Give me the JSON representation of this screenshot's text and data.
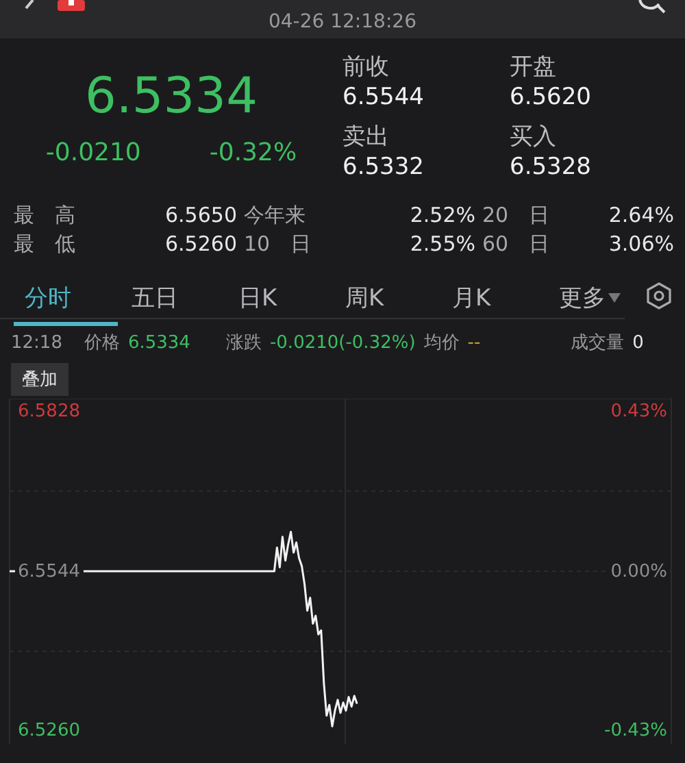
{
  "top_bar": {
    "datetime": "04-26 12:18:26"
  },
  "quote": {
    "price": "6.5334",
    "change": "-0.0210",
    "change_percent": "-0.32%"
  },
  "quote_fields": [
    {
      "label": "前收",
      "value": "6.5544"
    },
    {
      "label": "开盘",
      "value": "6.5620"
    },
    {
      "label": "卖出",
      "value": "6.5332"
    },
    {
      "label": "买入",
      "value": "6.5328"
    }
  ],
  "stats": [
    [
      {
        "label": "最　高",
        "value": "6.5650"
      },
      {
        "label": "今年来",
        "value": "2.52%"
      },
      {
        "label": "20　日",
        "value": "2.64%"
      }
    ],
    [
      {
        "label": "最　低",
        "value": "6.5260"
      },
      {
        "label": "10　日",
        "value": "2.55%"
      },
      {
        "label": "60　日",
        "value": "3.06%"
      }
    ]
  ],
  "tabs": [
    {
      "label": "分时",
      "selected": true
    },
    {
      "label": "五日",
      "selected": false
    },
    {
      "label": "日K",
      "selected": false
    },
    {
      "label": "周K",
      "selected": false
    },
    {
      "label": "月K",
      "selected": false
    },
    {
      "label": "更多",
      "selected": false,
      "dropdown": true
    }
  ],
  "info_row": {
    "time": "12:18",
    "price_label": "价格",
    "price": "6.5334",
    "change_label": "涨跌",
    "change": "-0.0210(-0.32%)",
    "avg_label": "均价",
    "avg": "--",
    "volume_label": "成交量",
    "volume": "0"
  },
  "overlay_button": "叠加",
  "chart": {
    "right_labels": [
      "0.43%",
      "0.00%",
      "-0.43%"
    ],
    "chart_data": {
      "type": "line",
      "ylim": [
        6.5238,
        6.585
      ],
      "yticks": [
        {
          "value": 6.5828,
          "label": "6.5828"
        },
        {
          "value": 6.5544,
          "label": "6.5544"
        },
        {
          "value": 6.526,
          "label": "6.5260"
        }
      ],
      "categories": [
        null,
        null,
        null,
        null,
        null,
        null,
        null,
        null,
        null,
        null,
        null,
        null,
        null,
        null,
        null,
        null,
        null,
        null,
        null,
        null,
        null,
        null,
        null,
        null,
        null,
        null,
        null,
        null,
        null,
        null,
        null,
        null,
        null,
        null,
        null,
        null,
        null,
        null,
        null,
        null,
        null,
        null,
        null,
        null,
        null,
        null,
        null,
        null,
        null,
        null,
        null,
        null,
        null,
        null,
        null,
        null,
        null,
        null,
        null,
        null,
        null,
        null,
        null,
        null,
        null,
        null,
        null,
        null,
        null,
        null,
        null,
        null,
        null,
        null,
        null,
        null,
        null,
        null,
        null,
        null,
        null,
        null,
        null,
        null,
        null,
        null,
        null,
        null,
        null,
        null,
        null,
        null,
        null,
        null,
        null,
        null,
        null,
        null,
        null,
        null,
        null,
        null,
        null,
        null,
        null,
        null,
        null,
        null,
        null,
        null,
        null,
        null,
        null,
        null,
        null,
        null,
        null,
        null,
        null,
        null,
        null,
        null,
        null,
        null,
        null,
        null,
        null,
        null,
        null,
        null,
        null,
        null,
        null,
        null,
        null,
        null,
        null,
        null,
        null,
        null,
        null,
        null,
        null,
        null,
        null,
        null,
        null,
        null,
        null,
        null,
        null,
        null,
        null,
        null,
        null,
        null,
        null,
        null,
        null,
        null,
        null,
        null,
        null,
        null,
        null,
        null,
        null,
        null,
        null,
        null,
        null,
        null,
        null,
        null,
        null,
        null,
        null,
        null,
        null,
        null,
        null,
        null,
        null,
        null,
        null,
        null,
        null,
        null,
        null,
        null,
        null,
        null,
        null,
        null,
        null,
        null,
        null,
        null,
        null,
        null,
        null,
        null,
        null,
        null,
        null,
        null,
        null,
        null,
        null,
        null,
        null,
        null,
        null,
        null,
        null,
        null,
        null,
        null,
        null,
        null,
        null,
        null,
        null,
        null,
        null,
        null,
        null,
        null,
        null,
        null,
        null,
        null,
        null,
        null,
        null,
        null,
        null,
        null,
        null,
        null,
        null
      ],
      "series": [
        {
          "color": "#f2f2f2",
          "values": [
            6.5544,
            6.5544,
            6.5544,
            6.5544,
            6.5544,
            6.5544,
            6.5544,
            6.5544,
            6.5544,
            6.5544,
            6.5544,
            6.5544,
            6.5544,
            6.5544,
            6.5544,
            6.5544,
            6.5544,
            6.5544,
            6.5544,
            6.5544,
            6.5544,
            6.5544,
            6.5544,
            6.5544,
            6.5544,
            6.5544,
            6.5544,
            6.5544,
            6.5544,
            6.5544,
            6.5544,
            6.5544,
            6.5544,
            6.5544,
            6.5544,
            6.5544,
            6.5544,
            6.5544,
            6.5544,
            6.5544,
            6.5544,
            6.5544,
            6.5544,
            6.5544,
            6.5544,
            6.5544,
            6.5544,
            6.5544,
            6.5544,
            6.5544,
            6.5544,
            6.5544,
            6.5544,
            6.5544,
            6.5544,
            6.5544,
            6.5544,
            6.5544,
            6.5544,
            6.5544,
            6.5544,
            6.5544,
            6.5544,
            6.5544,
            6.5544,
            6.5544,
            6.5544,
            6.5544,
            6.5544,
            6.5544,
            6.5544,
            6.5544,
            6.5544,
            6.5544,
            6.5544,
            6.5544,
            6.5544,
            6.5544,
            6.5544,
            6.5544,
            6.5544,
            6.5544,
            6.5544,
            6.5544,
            6.5544,
            6.5544,
            6.5544,
            6.5544,
            6.5544,
            6.5544,
            6.5544,
            6.5544,
            6.5544,
            6.5544,
            6.5544,
            6.5544,
            6.5544,
            6.5586,
            6.5551,
            6.5605,
            6.5563,
            6.5591,
            6.5614,
            6.5577,
            6.5595,
            6.5567,
            6.5553,
            6.5521,
            6.5474,
            6.5497,
            6.5451,
            6.5465,
            6.5432,
            6.5439,
            6.5346,
            6.5288,
            6.5307,
            6.5269,
            6.5297,
            6.5316,
            6.5293,
            6.5311,
            6.5297,
            6.5321,
            6.5304,
            6.5323,
            6.5309,
            null,
            null,
            null,
            null,
            null,
            null,
            null,
            null,
            null,
            null,
            null,
            null,
            null,
            null,
            null,
            null,
            null,
            null,
            null,
            null,
            null,
            null,
            null,
            null,
            null,
            null,
            null,
            null,
            null,
            null,
            null,
            null,
            null,
            null,
            null,
            null,
            null,
            null,
            null,
            null,
            null,
            null,
            null,
            null,
            null,
            null,
            null,
            null,
            null,
            null,
            null,
            null,
            null,
            null,
            null,
            null,
            null,
            null,
            null,
            null,
            null,
            null,
            null,
            null,
            null,
            null,
            null,
            null,
            null,
            null,
            null,
            null,
            null,
            null,
            null,
            null,
            null,
            null,
            null,
            null,
            null,
            null,
            null,
            null,
            null,
            null,
            null,
            null,
            null,
            null,
            null,
            null,
            null,
            null,
            null,
            null,
            null,
            null,
            null,
            null,
            null,
            null,
            null,
            null,
            null,
            null,
            null,
            null,
            null,
            null,
            null,
            null,
            null,
            null
          ]
        }
      ]
    }
  }
}
